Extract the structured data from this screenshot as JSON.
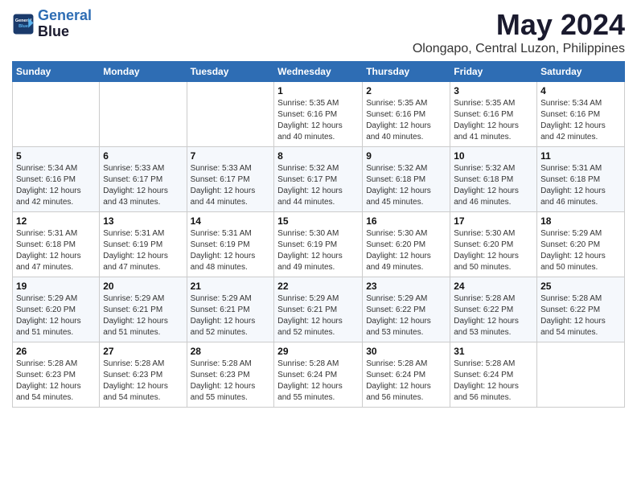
{
  "header": {
    "logo_line1": "General",
    "logo_line2": "Blue",
    "main_title": "May 2024",
    "subtitle": "Olongapo, Central Luzon, Philippines"
  },
  "weekdays": [
    "Sunday",
    "Monday",
    "Tuesday",
    "Wednesday",
    "Thursday",
    "Friday",
    "Saturday"
  ],
  "weeks": [
    [
      {
        "day": "",
        "info": ""
      },
      {
        "day": "",
        "info": ""
      },
      {
        "day": "",
        "info": ""
      },
      {
        "day": "1",
        "info": "Sunrise: 5:35 AM\nSunset: 6:16 PM\nDaylight: 12 hours\nand 40 minutes."
      },
      {
        "day": "2",
        "info": "Sunrise: 5:35 AM\nSunset: 6:16 PM\nDaylight: 12 hours\nand 40 minutes."
      },
      {
        "day": "3",
        "info": "Sunrise: 5:35 AM\nSunset: 6:16 PM\nDaylight: 12 hours\nand 41 minutes."
      },
      {
        "day": "4",
        "info": "Sunrise: 5:34 AM\nSunset: 6:16 PM\nDaylight: 12 hours\nand 42 minutes."
      }
    ],
    [
      {
        "day": "5",
        "info": "Sunrise: 5:34 AM\nSunset: 6:16 PM\nDaylight: 12 hours\nand 42 minutes."
      },
      {
        "day": "6",
        "info": "Sunrise: 5:33 AM\nSunset: 6:17 PM\nDaylight: 12 hours\nand 43 minutes."
      },
      {
        "day": "7",
        "info": "Sunrise: 5:33 AM\nSunset: 6:17 PM\nDaylight: 12 hours\nand 44 minutes."
      },
      {
        "day": "8",
        "info": "Sunrise: 5:32 AM\nSunset: 6:17 PM\nDaylight: 12 hours\nand 44 minutes."
      },
      {
        "day": "9",
        "info": "Sunrise: 5:32 AM\nSunset: 6:18 PM\nDaylight: 12 hours\nand 45 minutes."
      },
      {
        "day": "10",
        "info": "Sunrise: 5:32 AM\nSunset: 6:18 PM\nDaylight: 12 hours\nand 46 minutes."
      },
      {
        "day": "11",
        "info": "Sunrise: 5:31 AM\nSunset: 6:18 PM\nDaylight: 12 hours\nand 46 minutes."
      }
    ],
    [
      {
        "day": "12",
        "info": "Sunrise: 5:31 AM\nSunset: 6:18 PM\nDaylight: 12 hours\nand 47 minutes."
      },
      {
        "day": "13",
        "info": "Sunrise: 5:31 AM\nSunset: 6:19 PM\nDaylight: 12 hours\nand 47 minutes."
      },
      {
        "day": "14",
        "info": "Sunrise: 5:31 AM\nSunset: 6:19 PM\nDaylight: 12 hours\nand 48 minutes."
      },
      {
        "day": "15",
        "info": "Sunrise: 5:30 AM\nSunset: 6:19 PM\nDaylight: 12 hours\nand 49 minutes."
      },
      {
        "day": "16",
        "info": "Sunrise: 5:30 AM\nSunset: 6:20 PM\nDaylight: 12 hours\nand 49 minutes."
      },
      {
        "day": "17",
        "info": "Sunrise: 5:30 AM\nSunset: 6:20 PM\nDaylight: 12 hours\nand 50 minutes."
      },
      {
        "day": "18",
        "info": "Sunrise: 5:29 AM\nSunset: 6:20 PM\nDaylight: 12 hours\nand 50 minutes."
      }
    ],
    [
      {
        "day": "19",
        "info": "Sunrise: 5:29 AM\nSunset: 6:20 PM\nDaylight: 12 hours\nand 51 minutes."
      },
      {
        "day": "20",
        "info": "Sunrise: 5:29 AM\nSunset: 6:21 PM\nDaylight: 12 hours\nand 51 minutes."
      },
      {
        "day": "21",
        "info": "Sunrise: 5:29 AM\nSunset: 6:21 PM\nDaylight: 12 hours\nand 52 minutes."
      },
      {
        "day": "22",
        "info": "Sunrise: 5:29 AM\nSunset: 6:21 PM\nDaylight: 12 hours\nand 52 minutes."
      },
      {
        "day": "23",
        "info": "Sunrise: 5:29 AM\nSunset: 6:22 PM\nDaylight: 12 hours\nand 53 minutes."
      },
      {
        "day": "24",
        "info": "Sunrise: 5:28 AM\nSunset: 6:22 PM\nDaylight: 12 hours\nand 53 minutes."
      },
      {
        "day": "25",
        "info": "Sunrise: 5:28 AM\nSunset: 6:22 PM\nDaylight: 12 hours\nand 54 minutes."
      }
    ],
    [
      {
        "day": "26",
        "info": "Sunrise: 5:28 AM\nSunset: 6:23 PM\nDaylight: 12 hours\nand 54 minutes."
      },
      {
        "day": "27",
        "info": "Sunrise: 5:28 AM\nSunset: 6:23 PM\nDaylight: 12 hours\nand 54 minutes."
      },
      {
        "day": "28",
        "info": "Sunrise: 5:28 AM\nSunset: 6:23 PM\nDaylight: 12 hours\nand 55 minutes."
      },
      {
        "day": "29",
        "info": "Sunrise: 5:28 AM\nSunset: 6:24 PM\nDaylight: 12 hours\nand 55 minutes."
      },
      {
        "day": "30",
        "info": "Sunrise: 5:28 AM\nSunset: 6:24 PM\nDaylight: 12 hours\nand 56 minutes."
      },
      {
        "day": "31",
        "info": "Sunrise: 5:28 AM\nSunset: 6:24 PM\nDaylight: 12 hours\nand 56 minutes."
      },
      {
        "day": "",
        "info": ""
      }
    ]
  ]
}
